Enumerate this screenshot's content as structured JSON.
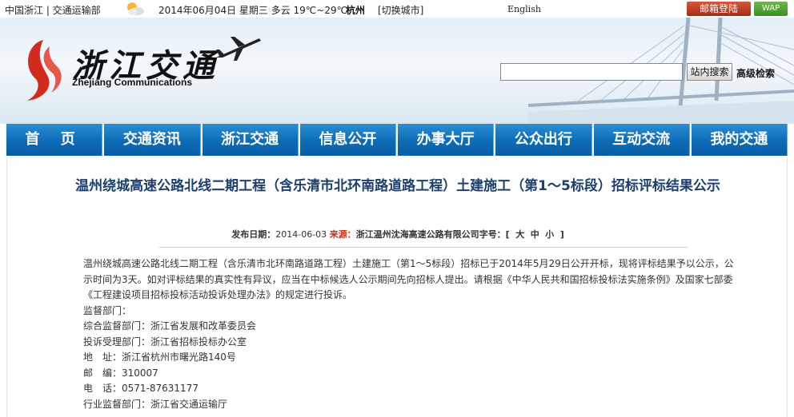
{
  "topbar": {
    "portal": "中国浙江 | 交通运输部",
    "date_weather": "2014年06月04日  星期三  多云  19℃~29℃",
    "city": "杭州",
    "switch_city": "[切换城市]",
    "english": "English",
    "mail_login": "邮箱登陆",
    "wap": "WAP",
    "weather_icon": "partly-cloudy-icon"
  },
  "banner": {
    "logo_text": "浙江交通",
    "logo_sub": "Zhejiang Communications",
    "search_placeholder": "",
    "search_button": "站内搜索",
    "advanced_search": "高级检索"
  },
  "nav": {
    "items": [
      {
        "label": "首 页"
      },
      {
        "label": "交通资讯"
      },
      {
        "label": "浙江交通"
      },
      {
        "label": "信息公开"
      },
      {
        "label": "办事大厅"
      },
      {
        "label": "公众出行"
      },
      {
        "label": "互动交流"
      },
      {
        "label": "我的交通"
      }
    ]
  },
  "article": {
    "title": "温州绕城高速公路北线二期工程（含乐清市北环南路道路工程）土建施工（第1～5标段）招标评标结果公示",
    "meta": {
      "date_label": "发布日期：",
      "date": "2014-06-03",
      "source_label": "来源：",
      "source": "浙江温州沈海高速公路有限公司",
      "font_label": "字号：[",
      "font_large": "大",
      "font_medium": "中",
      "font_small": "小",
      "font_end": "]"
    },
    "paragraph": "温州绕城高速公路北线二期工程（含乐清市北环南路道路工程）土建施工（第1～5标段）招标已于2014年5月29日公开开标，现将评标结果予以公示，公示时间为3天。如对评标结果的真实性有异议，应当在中标候选人公示期间先向招标人提出。请根据《中华人民共和国招标投标法实施条例》及国家七部委《工程建设项目招标投标活动投诉处理办法》的规定进行投诉。",
    "lines": [
      "监督部门：",
      "综合监督部门：浙江省发展和改革委员会",
      "投诉受理部门：浙江省招标投标办公室",
      "地　址：浙江省杭州市曙光路140号",
      "邮　编：310007",
      "电　话：0571-87631177",
      "行业监督部门：浙江省交通运输厅"
    ]
  }
}
